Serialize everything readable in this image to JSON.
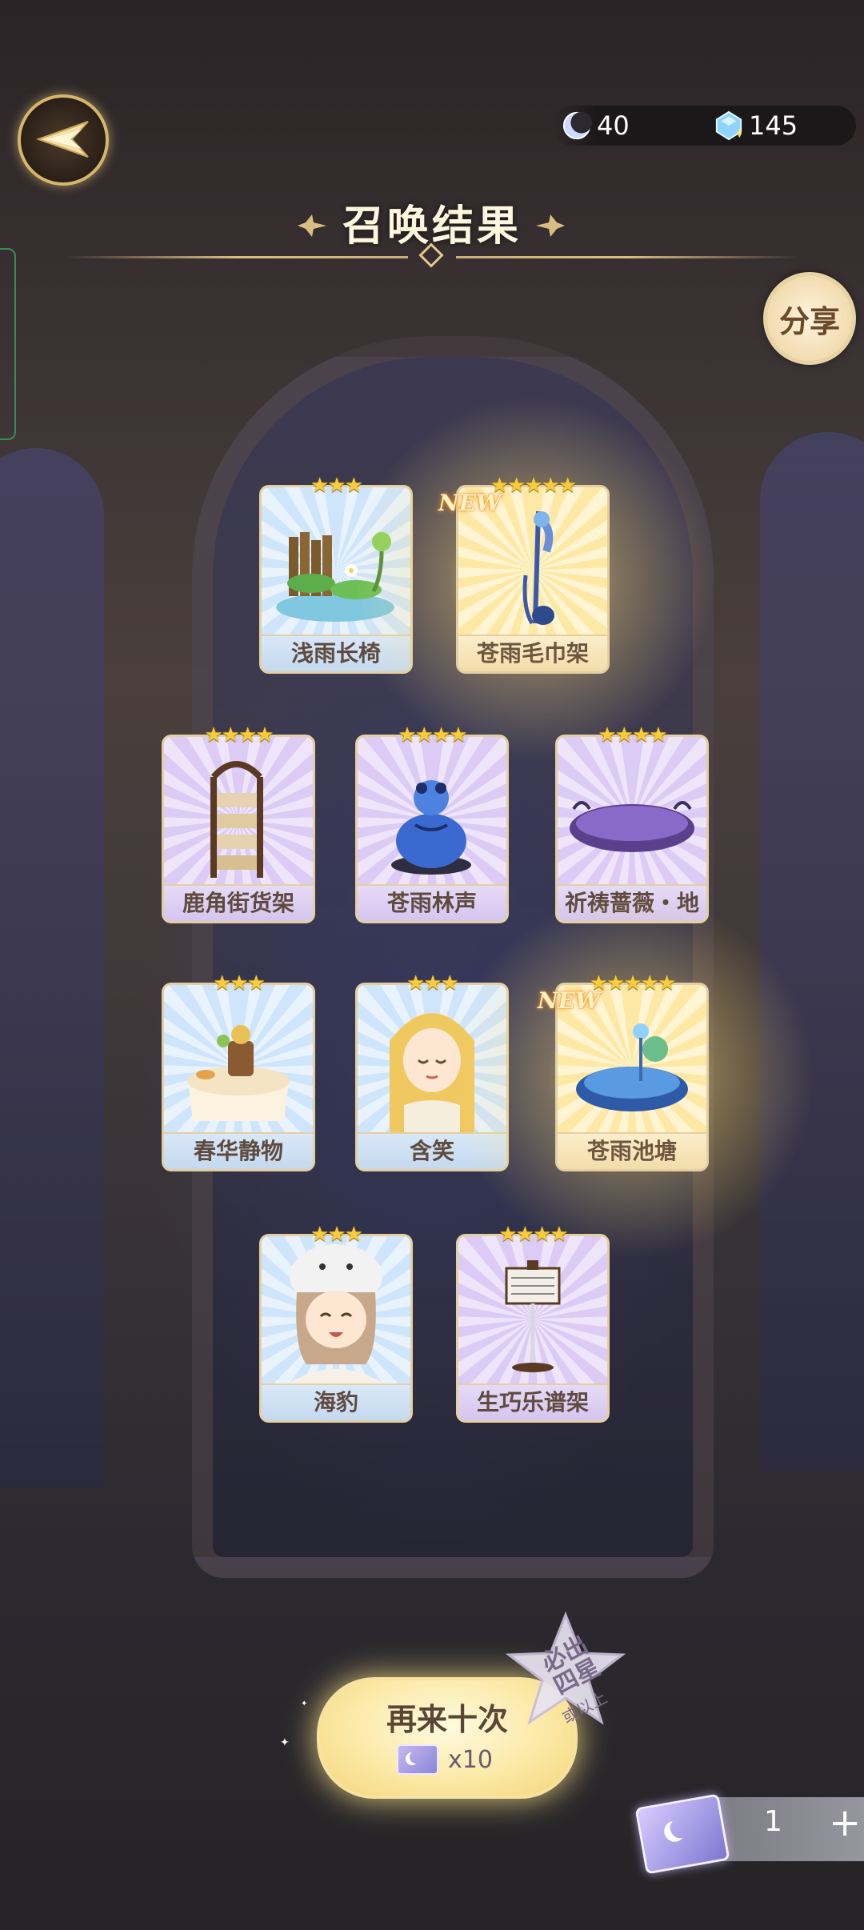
{
  "header": {
    "title": "召唤结果",
    "share_label": "分享"
  },
  "currency": {
    "moon_value": "40",
    "gem_value": "145"
  },
  "cards": [
    {
      "name": "浅雨长椅",
      "stars": "★★★",
      "rarity": 3,
      "is_new": false
    },
    {
      "name": "苍雨毛巾架",
      "stars": "★★★★★",
      "rarity": 5,
      "is_new": true
    },
    {
      "name": "鹿角街货架",
      "stars": "★★★★",
      "rarity": 4,
      "is_new": false
    },
    {
      "name": "苍雨林声",
      "stars": "★★★★",
      "rarity": 4,
      "is_new": false
    },
    {
      "name": "祈祷蔷薇・地台",
      "stars": "★★★★",
      "rarity": 4,
      "is_new": false
    },
    {
      "name": "春华静物",
      "stars": "★★★",
      "rarity": 3,
      "is_new": false
    },
    {
      "name": "含笑",
      "stars": "★★★",
      "rarity": 3,
      "is_new": false
    },
    {
      "name": "苍雨池塘",
      "stars": "★★★★★",
      "rarity": 5,
      "is_new": true
    },
    {
      "name": "海豹",
      "stars": "★★★",
      "rarity": 3,
      "is_new": false
    },
    {
      "name": "生巧乐谱架",
      "stars": "★★★★",
      "rarity": 4,
      "is_new": false
    }
  ],
  "new_badge": "NEW",
  "summon_again": {
    "label": "再来十次",
    "cost": "x10"
  },
  "guarantee_badge": {
    "line1": "必出",
    "line2": "四星",
    "sub": "或以上"
  },
  "ticket": {
    "count": "1",
    "plus": "+"
  },
  "colors": {
    "gold_border": "#e4cfa2",
    "star": "#f8cc3a",
    "rarity3": "#cfe5fb",
    "rarity4": "#dccbf4",
    "rarity5": "#fde8a6"
  }
}
